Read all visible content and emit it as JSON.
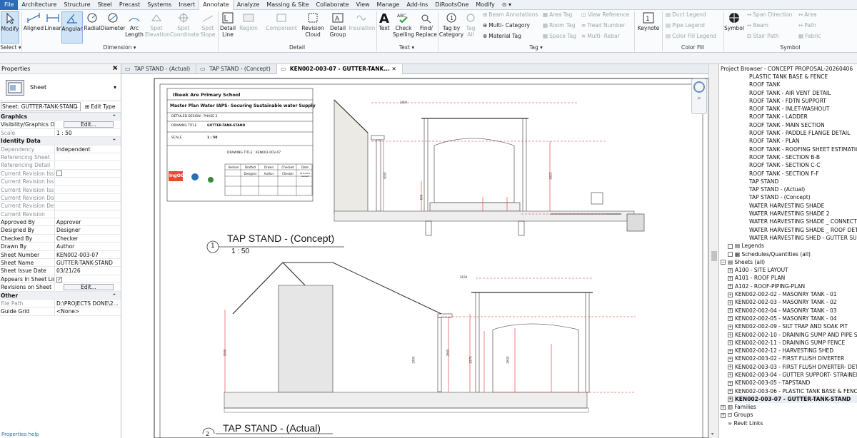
{
  "ribbon_tabs": [
    "File",
    "Architecture",
    "Structure",
    "Steel",
    "Precast",
    "Systems",
    "Insert",
    "Annotate",
    "Analyze",
    "Massing & Site",
    "Collaborate",
    "View",
    "Manage",
    "Add-Ins",
    "DiRootsOne",
    "Modify"
  ],
  "active_tab": "Annotate",
  "ribbon": {
    "modify": "Modify",
    "aligned": "Aligned",
    "linear": "Linear",
    "angular": "Angular",
    "radial": "Radial",
    "diameter": "Diameter",
    "arc_length": "Arc Length",
    "spot_elevation": "Spot Elevation",
    "spot_coordinate": "Spot Coordinate",
    "spot_slope": "Spot Slope",
    "detail_line": "Detail Line",
    "region": "Region",
    "component": "Component",
    "revision_cloud": "Revision Cloud",
    "detail_group": "Detail Group",
    "insulation": "Insulation",
    "text": "Text",
    "check_spelling": "Check Spelling",
    "find_replace": "Find/ Replace",
    "tag_by_category": "Tag by Category",
    "tag_all": "Tag All",
    "beam_annotations": "Beam Annotations",
    "multi_category": "Multi- Category",
    "material_tag": "Material Tag",
    "area_tag": "Area Tag",
    "room_tag": "Room Tag",
    "space_tag": "Space Tag",
    "view_reference": "View Reference",
    "tread_number": "Tread Number",
    "multi_rebar": "Multi- Rebar",
    "keynote": "Keynote",
    "duct_legend": "Duct Legend",
    "pipe_legend": "Pipe Legend",
    "color_fill_legend": "Color Fill Legend",
    "symbol": "Symbol",
    "span_direction": "Span Direction",
    "beam": "Beam",
    "stair_path": "Stair Path",
    "area": "Area",
    "path": "Path",
    "fabric": "Fabric",
    "panels": {
      "select": "Select",
      "dimension": "Dimension",
      "detail": "Detail",
      "text": "Text",
      "tag": "Tag",
      "color_fill": "Color Fill",
      "symbol": "Symbol"
    }
  },
  "properties": {
    "title": "Properties",
    "type_name": "Sheet",
    "instance_selector": "Sheet: GUTTER-TANK-STAND",
    "edit_type": "Edit Type",
    "rows": [
      {
        "k": "Graphics",
        "v": "",
        "group": true
      },
      {
        "k": "Visibility/Graphics O...",
        "v": "Edit...",
        "btn": true
      },
      {
        "k": "Scale",
        "v": "1 : 50",
        "dis": true
      },
      {
        "k": "Identity Data",
        "v": "",
        "group": true
      },
      {
        "k": "Dependency",
        "v": "Independent",
        "dis": true
      },
      {
        "k": "Referencing Sheet",
        "v": "",
        "dis": true
      },
      {
        "k": "Referencing Detail",
        "v": "",
        "dis": true
      },
      {
        "k": "Current Revision Issu...",
        "v": "",
        "dis": true,
        "check": true
      },
      {
        "k": "Current Revision Issu...",
        "v": "",
        "dis": true
      },
      {
        "k": "Current Revision Issu...",
        "v": "",
        "dis": true
      },
      {
        "k": "Current Revision Date",
        "v": "",
        "dis": true
      },
      {
        "k": "Current Revision Des...",
        "v": "",
        "dis": true
      },
      {
        "k": "Current Revision",
        "v": "",
        "dis": true
      },
      {
        "k": "Approved By",
        "v": "Approver"
      },
      {
        "k": "Designed By",
        "v": "Designer"
      },
      {
        "k": "Checked By",
        "v": "Checker"
      },
      {
        "k": "Drawn By",
        "v": "Author"
      },
      {
        "k": "Sheet Number",
        "v": "KEN002-003-07"
      },
      {
        "k": "Sheet Name",
        "v": "GUTTER-TANK-STAND"
      },
      {
        "k": "Sheet Issue Date",
        "v": "03/21/26"
      },
      {
        "k": "Appears In Sheet List",
        "v": "",
        "check": true,
        "checked": true
      },
      {
        "k": "Revisions on Sheet",
        "v": "Edit...",
        "btn": true
      },
      {
        "k": "Other",
        "v": "",
        "group": true
      },
      {
        "k": "File Path",
        "v": "D:\\PROJECTS DONE\\2...",
        "dis": true
      },
      {
        "k": "Guide Grid",
        "v": "<None>"
      }
    ],
    "help": "Properties help"
  },
  "view_tabs": [
    {
      "label": "TAP STAND - (Actual)",
      "active": false
    },
    {
      "label": "TAP STAND - (Concept)",
      "active": false
    },
    {
      "label": "KEN002-003-07 - GUTTER-TANK...",
      "active": true
    }
  ],
  "sheet": {
    "school": "Ilkeek Are Primary School",
    "project": "Master Plan Water IAPS- Securing Sustainable water Supply",
    "design": "DETAILED DESIGN - PHASE 2",
    "drawing_title_label": "DRAWING TITLE",
    "drawing_title_value": "GUTTER-TANK-STAND",
    "scale_label": "SCALE",
    "scale_value": "1 : 50",
    "drawing_title_full": "DRAWING TITLE : KEN002-003-07",
    "rev_headers": [
      "Version",
      "Drafted",
      "Drawn",
      "Checked",
      "Date"
    ],
    "rev_row": [
      "",
      "Designer",
      "Author",
      "Checker",
      "as built & revised"
    ],
    "logo": "IngOG",
    "view1_num": "1",
    "view1_title": "TAP STAND - (Concept)",
    "view1_scale": "1 : 50",
    "view2_num": "2",
    "view2_title": "TAP STAND - (Actual)",
    "dims": [
      "2804",
      "3000",
      "2623",
      "600",
      "2639",
      "3000",
      "2900",
      "2660",
      "2570",
      "2600"
    ]
  },
  "project_browser": {
    "title": "Project Browser - CONCEPT PROPOSAL-20260406",
    "views": [
      "PLASTIC TANK BASE & FENCE",
      "ROOF TANK",
      "ROOF TANK - AIR VENT DETAIL",
      "ROOF TANK - FDTN SUPPORT",
      "ROOF TANK - INLET-WASHOUT",
      "ROOF TANK - LADDER",
      "ROOF TANK - MAIN SECTION",
      "ROOF TANK - PADDLE FLANGE DETAIL",
      "ROOF TANK - PLAN",
      "ROOF TANK - ROOFING SHEET ESTIMATION",
      "ROOF TANK - SECTION B-B",
      "ROOF TANK - SECTION C-C",
      "ROOF TANK - SECTION F-F",
      "TAP STAND",
      "TAP STAND - (Actual)",
      "TAP STAND - (Concept)",
      "WATER HARVESTING SHADE",
      "WATER HARVESTING SHADE 2",
      "WATER HARVESTING SHADE _ CONNECTION",
      "WATER HARVESTING SHADE _ ROOF DETAILS",
      "WATER HARVESTING SHED - GUTTER SUPPORT"
    ],
    "legends": "Legends",
    "schedules": "Schedules/Quantities (all)",
    "sheets_label": "Sheets (all)",
    "sheets": [
      "A100 - SITE LAYOUT",
      "A101 - ROOF PLAN",
      "A102 - ROOF-PIPING-PLAN",
      "KEN002-002-02 - MASONRY TANK - 01",
      "KEN002-002-03 - MASONRY TANK - 02",
      "KEN002-002-04 - MASONRY TANK - 03",
      "KEN002-002-05 - MASONRY TANK - 04",
      "KEN002-002-09 - SILT TRAP AND SOAK PIT",
      "KEN002-002-10 - DRAINING SUMP AND PIPE SECTION",
      "KEN002-002-11 - DRAINING SUMP FENCE",
      "KEN002-002-12 - HARVESTING SHED",
      "KEN002-003-02 - FIRST FLUSH DIVERTER",
      "KEN002-003-03 - FIRST FLUSH DIVERTER- DETAIL",
      "KEN002-003-04 - GUTTER SUPPORT- STRAINER DETAIL",
      "KEN002-003-05 - TAPSTAND",
      "KEN002-003-06 - PLASTIC TANK BASE & FENCE",
      "KEN002-003-07 - GUTTER-TANK-STAND"
    ],
    "selected_sheet": "KEN002-003-07 - GUTTER-TANK-STAND",
    "families": "Families",
    "groups": "Groups",
    "revit_links": "Revit Links"
  },
  "colors": {
    "accent": "#2b6cb8",
    "dim_red": "#e03030",
    "selection": "#cfe3f6"
  }
}
